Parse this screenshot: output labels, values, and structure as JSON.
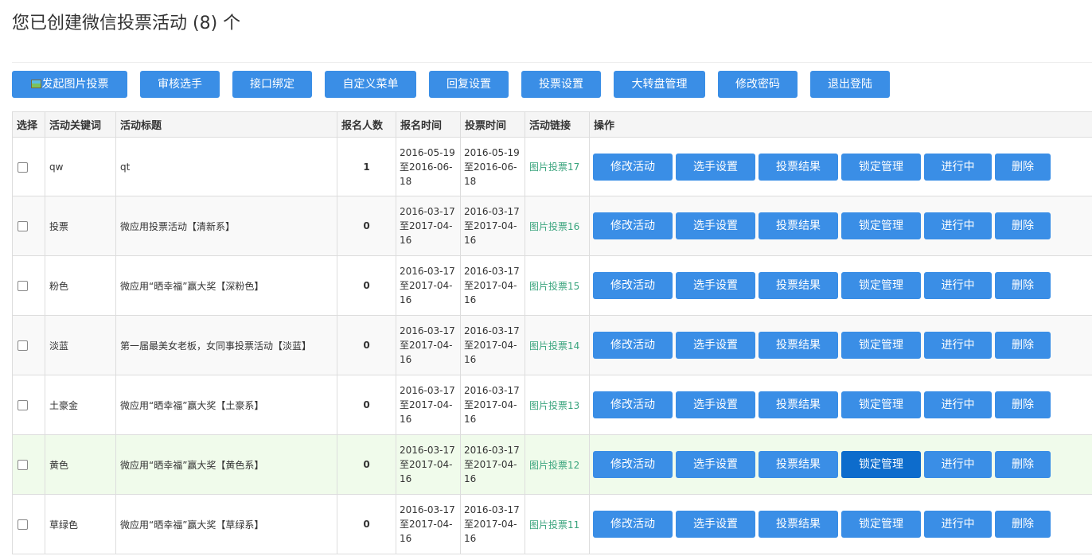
{
  "page": {
    "title": "您已创建微信投票活动 (8) 个"
  },
  "toolbar": [
    {
      "label": "发起图片投票",
      "icon": "image-icon"
    },
    {
      "label": "审核选手"
    },
    {
      "label": "接口绑定"
    },
    {
      "label": "自定义菜单"
    },
    {
      "label": "回复设置"
    },
    {
      "label": "投票设置"
    },
    {
      "label": "大转盘管理"
    },
    {
      "label": "修改密码"
    },
    {
      "label": "退出登陆"
    }
  ],
  "table": {
    "headers": [
      "选择",
      "活动关键词",
      "活动标题",
      "报名人数",
      "报名时间",
      "投票时间",
      "活动链接",
      "操作"
    ],
    "row_actions": [
      "修改活动",
      "选手设置",
      "投票结果",
      "锁定管理",
      "进行中",
      "删除"
    ],
    "rows": [
      {
        "keyword": "qw",
        "title": "qt",
        "count": "1",
        "signup_time": "2016-05-19至2016-06-18",
        "vote_time": "2016-05-19至2016-06-18",
        "link": "图片投票17"
      },
      {
        "keyword": "投票",
        "title": "微应用投票活动【清新系】",
        "count": "0",
        "signup_time": "2016-03-17至2017-04-16",
        "vote_time": "2016-03-17至2017-04-16",
        "link": "图片投票16"
      },
      {
        "keyword": "粉色",
        "title": "微应用“晒幸福”赢大奖【深粉色】",
        "count": "0",
        "signup_time": "2016-03-17至2017-04-16",
        "vote_time": "2016-03-17至2017-04-16",
        "link": "图片投票15"
      },
      {
        "keyword": "淡蓝",
        "title": "第一届最美女老板，女同事投票活动【淡蓝】",
        "count": "0",
        "signup_time": "2016-03-17至2017-04-16",
        "vote_time": "2016-03-17至2017-04-16",
        "link": "图片投票14"
      },
      {
        "keyword": "土豪金",
        "title": "微应用“晒幸福”赢大奖【土豪系】",
        "count": "0",
        "signup_time": "2016-03-17至2017-04-16",
        "vote_time": "2016-03-17至2017-04-16",
        "link": "图片投票13"
      },
      {
        "keyword": "黄色",
        "title": "微应用“晒幸福”赢大奖【黄色系】",
        "count": "0",
        "signup_time": "2016-03-17至2017-04-16",
        "vote_time": "2016-03-17至2017-04-16",
        "link": "图片投票12"
      },
      {
        "keyword": "草绿色",
        "title": "微应用“晒幸福”赢大奖【草绿系】",
        "count": "0",
        "signup_time": "2016-03-17至2017-04-16",
        "vote_time": "2016-03-17至2017-04-16",
        "link": "图片投票11"
      }
    ]
  },
  "colors": {
    "button": "#3a8ee6",
    "button_active": "#0d6ccc",
    "link": "#3aa47d",
    "row_highlight": "#f0fbeb"
  }
}
